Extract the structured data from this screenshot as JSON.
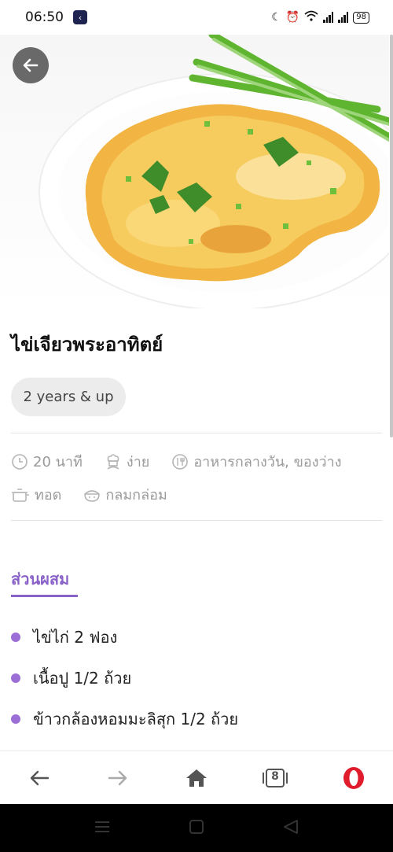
{
  "status_bar": {
    "time": "06:50",
    "app_icon_glyph": "‹",
    "battery": "98"
  },
  "recipe": {
    "title": "ไข่เจียวพระอาทิตย์",
    "age": "2 years & up",
    "meta": {
      "time": "20 นาที",
      "difficulty": "ง่าย",
      "meal": "อาหารกลางวัน, ของว่าง",
      "method": "ทอด",
      "texture": "กลมกล่อม"
    }
  },
  "ingredients": {
    "title": "ส่วนผสม",
    "items": [
      "ไข่ไก่ 2 ฟอง",
      "เนื้อปู 1/2 ถ้วย",
      "ข้าวกล้องหอมมะลิสุก 1/2 ถ้วย"
    ]
  },
  "browser_bar": {
    "tabs_count": "8"
  },
  "colors": {
    "accent": "#8a63c8",
    "dot": "#9b6fd6",
    "opera": "#e01c2c"
  }
}
